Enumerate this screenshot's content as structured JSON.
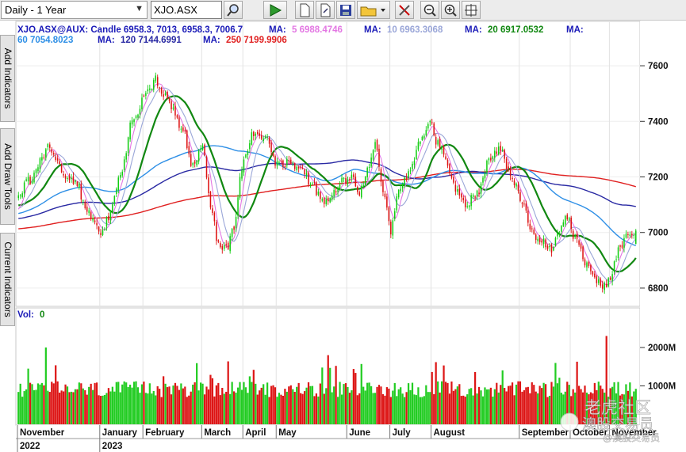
{
  "toolbar": {
    "period_select": "Daily - 1 Year",
    "symbol_input": "XJO.ASX",
    "buttons": [
      "search",
      "play",
      "new",
      "open",
      "save",
      "folder",
      "tools",
      "zoom-out",
      "zoom-in",
      "fit"
    ]
  },
  "side_tabs": [
    "Add Indicators",
    "Add Draw Tools",
    "Current Indicators"
  ],
  "legend": {
    "candle_label": "XJO.ASX@AUX: Candle 6958.3, 7013, 6958.3, 7006.7",
    "items": [
      {
        "label": "MA:",
        "value": "5 6988.4746",
        "color": "#e377e3"
      },
      {
        "label": "MA:",
        "value": "10 6963.3068",
        "color": "#9aa6d8"
      },
      {
        "label": "MA:",
        "value": "20 6917.0532",
        "color": "#118811"
      },
      {
        "label": "MA:",
        "value": "60 7054.8023",
        "color": "#2e8fe6"
      },
      {
        "label": "MA:",
        "value": "120 7144.6991",
        "color": "#2929a3"
      },
      {
        "label": "MA:",
        "value": "250 7199.9906",
        "color": "#e02020"
      }
    ]
  },
  "vol_label": {
    "label": "Vol:",
    "value": "0"
  },
  "watermark": [
    "老虎社区",
    "澳股交易员",
    "@澳股交易员"
  ],
  "chart_data": {
    "type": "candlestick",
    "price_axis": {
      "ylim": [
        6740,
        7660
      ],
      "ticks": [
        6800,
        7000,
        7200,
        7400,
        7600
      ]
    },
    "volume_axis": {
      "ylim": [
        0,
        2700
      ],
      "ticks_millions": [
        1000,
        2000
      ],
      "tick_labels": [
        "1000M",
        "2000M"
      ]
    },
    "x_axis": {
      "months": [
        "November",
        "January",
        "February",
        "March",
        "April",
        "May",
        "June",
        "July",
        "August",
        "September",
        "October",
        "November"
      ],
      "month_index": [
        0,
        42,
        64,
        94,
        115,
        132,
        168,
        190,
        211,
        256,
        282,
        302
      ],
      "years": [
        {
          "label": "2022",
          "index": 0
        },
        {
          "label": "2023",
          "index": 42
        }
      ],
      "count": 316
    },
    "anchors": [
      [
        0,
        7140
      ],
      [
        6,
        7190
      ],
      [
        12,
        7260
      ],
      [
        16,
        7310
      ],
      [
        20,
        7260
      ],
      [
        24,
        7200
      ],
      [
        30,
        7180
      ],
      [
        34,
        7090
      ],
      [
        38,
        7050
      ],
      [
        42,
        6980
      ],
      [
        46,
        7060
      ],
      [
        52,
        7200
      ],
      [
        58,
        7400
      ],
      [
        66,
        7500
      ],
      [
        70,
        7550
      ],
      [
        74,
        7500
      ],
      [
        78,
        7450
      ],
      [
        84,
        7370
      ],
      [
        88,
        7250
      ],
      [
        94,
        7300
      ],
      [
        98,
        7100
      ],
      [
        102,
        6960
      ],
      [
        106,
        6940
      ],
      [
        110,
        7020
      ],
      [
        114,
        7240
      ],
      [
        120,
        7360
      ],
      [
        126,
        7350
      ],
      [
        132,
        7240
      ],
      [
        138,
        7250
      ],
      [
        144,
        7230
      ],
      [
        150,
        7170
      ],
      [
        156,
        7100
      ],
      [
        160,
        7140
      ],
      [
        164,
        7180
      ],
      [
        170,
        7200
      ],
      [
        174,
        7140
      ],
      [
        178,
        7230
      ],
      [
        182,
        7320
      ],
      [
        186,
        7150
      ],
      [
        190,
        7010
      ],
      [
        194,
        7140
      ],
      [
        200,
        7240
      ],
      [
        206,
        7340
      ],
      [
        210,
        7400
      ],
      [
        214,
        7320
      ],
      [
        218,
        7260
      ],
      [
        224,
        7140
      ],
      [
        228,
        7100
      ],
      [
        234,
        7140
      ],
      [
        240,
        7260
      ],
      [
        246,
        7300
      ],
      [
        252,
        7190
      ],
      [
        258,
        7100
      ],
      [
        262,
        7000
      ],
      [
        266,
        6980
      ],
      [
        272,
        6940
      ],
      [
        276,
        7000
      ],
      [
        280,
        7060
      ],
      [
        284,
        6980
      ],
      [
        290,
        6880
      ],
      [
        294,
        6840
      ],
      [
        298,
        6800
      ],
      [
        302,
        6830
      ],
      [
        306,
        6930
      ],
      [
        310,
        6990
      ],
      [
        315,
        7006
      ]
    ],
    "volume_spikes": [
      [
        14,
        2000
      ],
      [
        99,
        1200
      ],
      [
        158,
        1800
      ],
      [
        300,
        2300
      ]
    ],
    "moving_averages": [
      {
        "name": "MA 5",
        "period": 5,
        "last": 6988.4746,
        "color": "#e377e3"
      },
      {
        "name": "MA 10",
        "period": 10,
        "last": 6963.3068,
        "color": "#9aa6d8"
      },
      {
        "name": "MA 20",
        "period": 20,
        "last": 6917.0532,
        "color": "#118811"
      },
      {
        "name": "MA 60",
        "period": 60,
        "last": 7054.8023,
        "color": "#2e8fe6"
      },
      {
        "name": "MA 120",
        "period": 120,
        "last": 7144.6991,
        "color": "#2929a3"
      },
      {
        "name": "MA 250",
        "period": 250,
        "last": 7199.9906,
        "color": "#e02020"
      }
    ],
    "last_candle": {
      "open": 6958.3,
      "high": 7013,
      "low": 6958.3,
      "close": 7006.7
    },
    "colors": {
      "up": "#11cc11",
      "down": "#dd1111"
    }
  }
}
